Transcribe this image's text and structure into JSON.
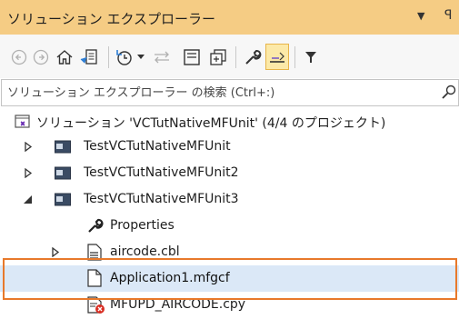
{
  "window": {
    "title": "ソリューション エクスプローラー",
    "menu_glyph": "▼",
    "pin_glyph": "ꟼ"
  },
  "toolbar": {
    "buttons": [
      {
        "icon": "back-icon"
      },
      {
        "icon": "forward-icon"
      },
      {
        "icon": "home-icon"
      },
      {
        "icon": "switch-views-icon"
      },
      {
        "icon": "pending-changes-filter-icon"
      },
      {
        "icon": "sync-with-active-document-icon"
      },
      {
        "icon": "collapse-all-icon"
      },
      {
        "icon": "show-all-files-icon"
      },
      {
        "icon": "properties-wrench-icon"
      },
      {
        "icon": "preview-selected-items-icon"
      },
      {
        "icon": "filter-icon"
      }
    ]
  },
  "search": {
    "placeholder": "ソリューション エクスプローラー の検索 (Ctrl+:)"
  },
  "tree": {
    "solution": "ソリューション 'VCTutNativeMFUnit' (4/4 のプロジェクト)",
    "items": [
      {
        "label": "TestVCTutNativeMFUnit",
        "expander": "▷"
      },
      {
        "label": "TestVCTutNativeMFUnit2",
        "expander": "▷"
      },
      {
        "label": "TestVCTutNativeMFUnit3",
        "expander": "◢"
      },
      {
        "label": "Properties"
      },
      {
        "label": "aircode.cbl",
        "expander": "▷"
      },
      {
        "label": "Application1.mfgcf"
      },
      {
        "label": "MFUPD_AIRCODE.cpy"
      }
    ]
  },
  "colors": {
    "title_bar": "#f5cc84",
    "selection": "#dbe8f7",
    "highlight_border": "#e8792b",
    "project_icon": "#3a4b63"
  }
}
